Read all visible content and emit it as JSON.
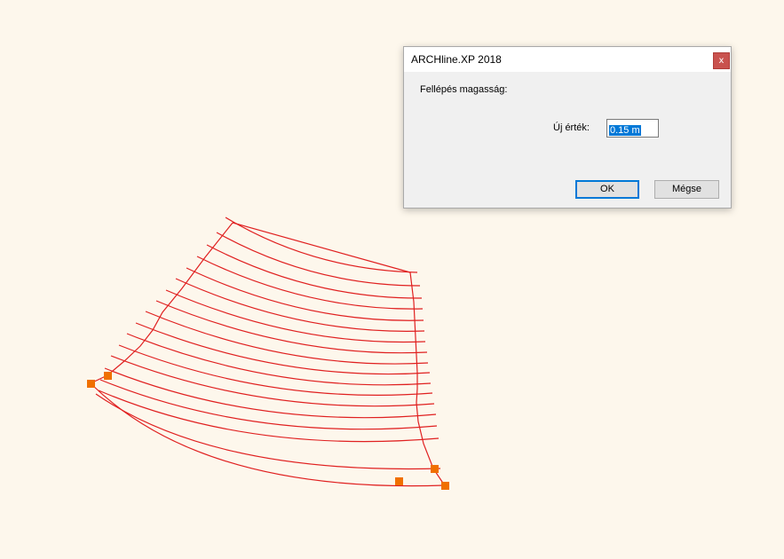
{
  "dialog": {
    "title": "ARCHline.XP 2018",
    "close_label": "x",
    "prompt": "Fellépés magasság:",
    "value_label": "Új érték:",
    "value": "0.15 m",
    "ok_label": "OK",
    "cancel_label": "Mégse"
  },
  "drawing": {
    "line_color": "#e02020",
    "grip_color": "#f07000",
    "step_count": 16
  }
}
